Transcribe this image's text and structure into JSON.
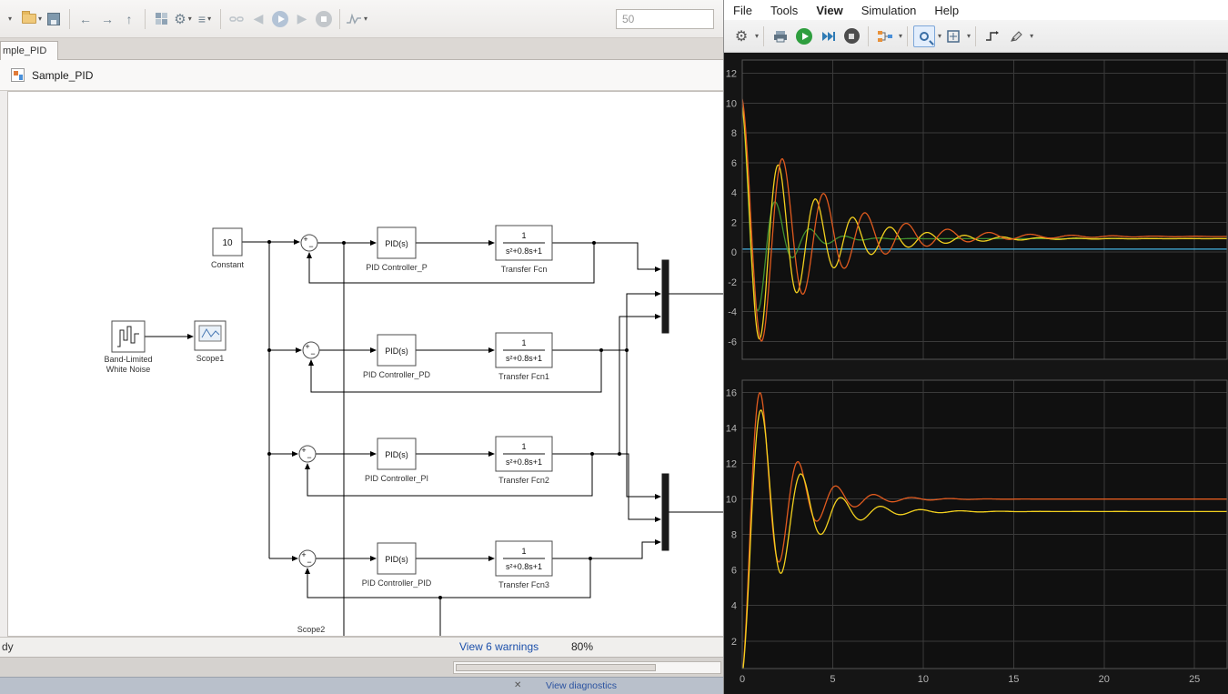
{
  "icons": {
    "caret": "▾",
    "back": "←",
    "forward": "→",
    "up": "↑",
    "gear": "⚙",
    "list": "≡",
    "close": "✕",
    "plus": "+",
    "minus": "−"
  },
  "simulink": {
    "toolbar": {
      "stop_time": "50"
    },
    "tab": "mple_PID",
    "breadcrumb": "Sample_PID",
    "status": {
      "ready": "dy",
      "warnings_link": "View 6 warnings",
      "zoom_level": "80%"
    },
    "bottom": {
      "diagnostics_link": "View diagnostics"
    },
    "blocks": {
      "constant": {
        "value": "10",
        "label": "Constant"
      },
      "noise": {
        "line1": "Band-Limited",
        "line2": "White Noise"
      },
      "scope1": {
        "label": "Scope1"
      },
      "scope2": {
        "label": "Scope2"
      },
      "pid": [
        {
          "text": "PID(s)",
          "label": "PID Controller_P"
        },
        {
          "text": "PID(s)",
          "label": "PID Controller_PD"
        },
        {
          "text": "PID(s)",
          "label": "PID Controller_PI"
        },
        {
          "text": "PID(s)",
          "label": "PID Controller_PID"
        }
      ],
      "tf": [
        {
          "num": "1",
          "den": "s²+0.8s+1",
          "label": "Transfer Fcn"
        },
        {
          "num": "1",
          "den": "s²+0.8s+1",
          "label": "Transfer Fcn1"
        },
        {
          "num": "1",
          "den": "s²+0.8s+1",
          "label": "Transfer Fcn2"
        },
        {
          "num": "1",
          "den": "s²+0.8s+1",
          "label": "Transfer Fcn3"
        }
      ]
    }
  },
  "scope": {
    "menu": [
      "File",
      "Tools",
      "View",
      "Simulation",
      "Help"
    ]
  },
  "chart_data": [
    {
      "type": "line",
      "title": "",
      "xlabel": "",
      "ylabel": "",
      "grid": true,
      "legend": "none",
      "background": "#101010",
      "xlim": [
        0,
        26.8
      ],
      "ylim": [
        -7.2,
        12.9
      ],
      "xticks": [
        0,
        5,
        10,
        15,
        20,
        25
      ],
      "yticks": [
        -6,
        -4,
        -2,
        0,
        2,
        4,
        6,
        8,
        10,
        12
      ],
      "series": [
        {
          "name": "cyan-flat",
          "color": "#45b4e3",
          "model": {
            "kind": "flat",
            "value": 0.2
          }
        },
        {
          "name": "green",
          "color": "#3f8f2f",
          "model": {
            "kind": "damped",
            "final": 0.9,
            "amp": 9.0,
            "decay": 0.7,
            "freq": 3.3,
            "phase": 0.1
          }
        },
        {
          "name": "yellow",
          "color": "#f2d01e",
          "model": {
            "kind": "damped",
            "final": 0.9,
            "amp": 9.0,
            "decay": 0.3,
            "freq": 3.05,
            "phase": 0.15
          }
        },
        {
          "name": "orange",
          "color": "#e05a1e",
          "model": {
            "kind": "damped",
            "final": 1.05,
            "amp": 9.3,
            "decay": 0.26,
            "freq": 2.75,
            "phase": 0.12
          }
        }
      ]
    },
    {
      "type": "line",
      "title": "",
      "xlabel": "",
      "ylabel": "",
      "grid": true,
      "legend": "none",
      "background": "#101010",
      "xlim": [
        0,
        26.8
      ],
      "ylim": [
        0.45,
        16.7
      ],
      "xticks": [
        0,
        5,
        10,
        15,
        20,
        25
      ],
      "yticks": [
        2,
        4,
        6,
        8,
        10,
        12,
        14,
        16
      ],
      "series": [
        {
          "name": "orange",
          "color": "#e05a1e",
          "model": {
            "kind": "damped",
            "final": 10.0,
            "amp": -9.9,
            "decay": 0.5,
            "freq": 3.0,
            "phase": 0.05
          }
        },
        {
          "name": "yellow",
          "color": "#f2d01e",
          "model": {
            "kind": "damped",
            "final": 9.3,
            "amp": -9.2,
            "decay": 0.45,
            "freq": 2.85,
            "phase": 0.05
          }
        }
      ]
    }
  ]
}
